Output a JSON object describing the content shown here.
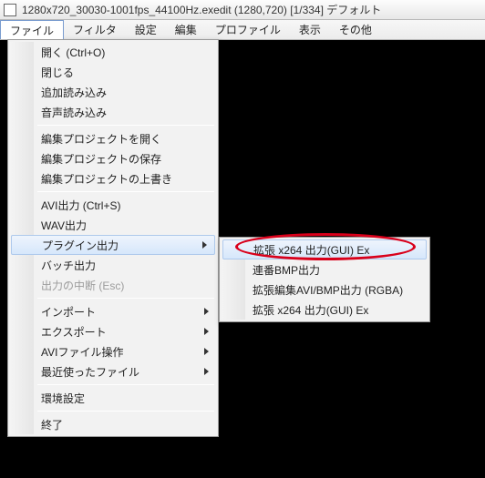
{
  "window": {
    "title": "1280x720_30030-1001fps_44100Hz.exedit (1280,720) [1/334] デフォルト"
  },
  "menubar": {
    "items": [
      {
        "label": "ファイル",
        "active": true
      },
      {
        "label": "フィルタ"
      },
      {
        "label": "設定"
      },
      {
        "label": "編集"
      },
      {
        "label": "プロファイル"
      },
      {
        "label": "表示"
      },
      {
        "label": "その他"
      }
    ]
  },
  "file_menu": {
    "groups": [
      [
        {
          "label": "開く (Ctrl+O)"
        },
        {
          "label": "閉じる"
        },
        {
          "label": "追加読み込み"
        },
        {
          "label": "音声読み込み"
        }
      ],
      [
        {
          "label": "編集プロジェクトを開く"
        },
        {
          "label": "編集プロジェクトの保存"
        },
        {
          "label": "編集プロジェクトの上書き"
        }
      ],
      [
        {
          "label": "AVI出力 (Ctrl+S)"
        },
        {
          "label": "WAV出力"
        },
        {
          "label": "プラグイン出力",
          "submenu": true,
          "highlight": true
        },
        {
          "label": "バッチ出力"
        },
        {
          "label": "出力の中断 (Esc)",
          "disabled": true
        }
      ],
      [
        {
          "label": "インポート",
          "submenu": true
        },
        {
          "label": "エクスポート",
          "submenu": true
        },
        {
          "label": "AVIファイル操作",
          "submenu": true
        },
        {
          "label": "最近使ったファイル",
          "submenu": true
        }
      ],
      [
        {
          "label": "環境設定"
        }
      ],
      [
        {
          "label": "終了"
        }
      ]
    ]
  },
  "plugin_submenu": {
    "items": [
      {
        "label": "拡張 x264 出力(GUI) Ex",
        "highlight": true
      },
      {
        "label": "連番BMP出力"
      },
      {
        "label": "拡張編集AVI/BMP出力 (RGBA)"
      },
      {
        "label": "拡張 x264 出力(GUI) Ex"
      }
    ]
  },
  "annotation": {
    "ellipse_color": "#d9001b"
  }
}
